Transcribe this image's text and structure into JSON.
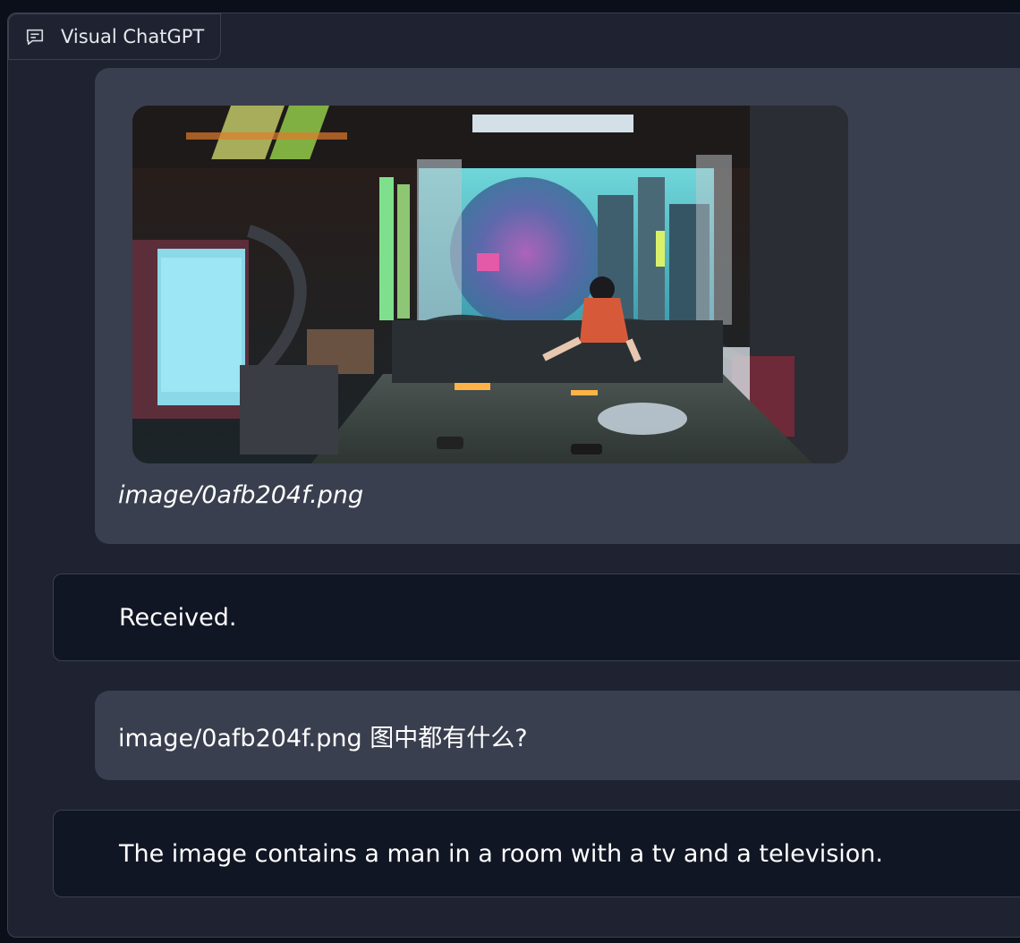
{
  "tab": {
    "label": "Visual ChatGPT",
    "icon": "chat-bubble-icon"
  },
  "messages": {
    "image_message": {
      "caption": "image/0afb204f.png"
    },
    "received": {
      "text": "Received."
    },
    "question": {
      "text": "image/0afb204f.png 图中都有什么?"
    },
    "answer": {
      "text": "The image contains a man in a room with a tv and a television."
    }
  },
  "colors": {
    "page_bg": "#0b0f19",
    "panel_bg": "#1f2331",
    "user_bubble": "#3a3f4f",
    "bot_bubble": "#111624",
    "border": "#3b4050"
  }
}
